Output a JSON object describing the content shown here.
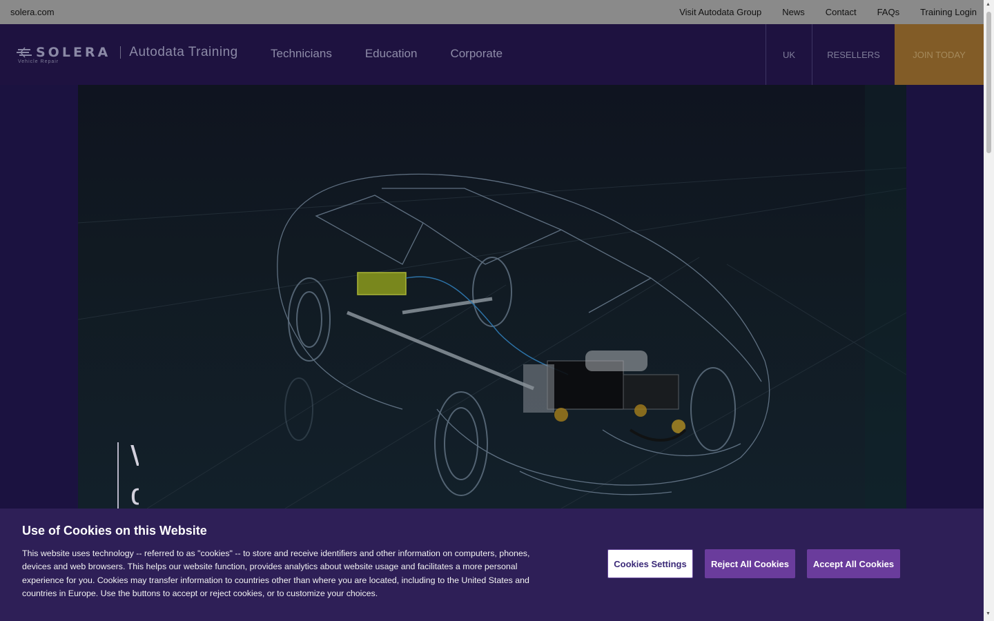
{
  "utility_bar": {
    "left_link": "solera.com",
    "links": [
      "Visit Autodata Group",
      "News",
      "Contact",
      "FAQs",
      "Training Login"
    ]
  },
  "brand": {
    "wordmark": "SOLERA",
    "sub": "Vehicle Repair",
    "product": "Autodata Training"
  },
  "nav": {
    "links": [
      "Technicians",
      "Education",
      "Corporate"
    ],
    "region": "UK",
    "resellers": "RESELLERS",
    "join": "JOIN TODAY"
  },
  "hero": {
    "text": "W\nd"
  },
  "cookie": {
    "title": "Use of Cookies on this Website",
    "body": "This website uses technology -- referred to as \"cookies\" -- to store and receive identifiers and other information on computers, phones, devices and web browsers. This helps our website function, provides analytics about website usage and facilitates a more personal experience for you. Cookies may transfer information to countries other than where you are located, including to the United States and countries in Europe. Use the buttons to accept or reject cookies, or to customize your choices.",
    "settings_label": "Cookies Settings",
    "reject_label": "Reject All Cookies",
    "accept_label": "Accept All Cookies"
  },
  "colors": {
    "nav_bg": "#1e1240",
    "join_bg": "#825c27",
    "cookie_bg": "#2e1f57",
    "cookie_button": "#6a3c9c"
  }
}
